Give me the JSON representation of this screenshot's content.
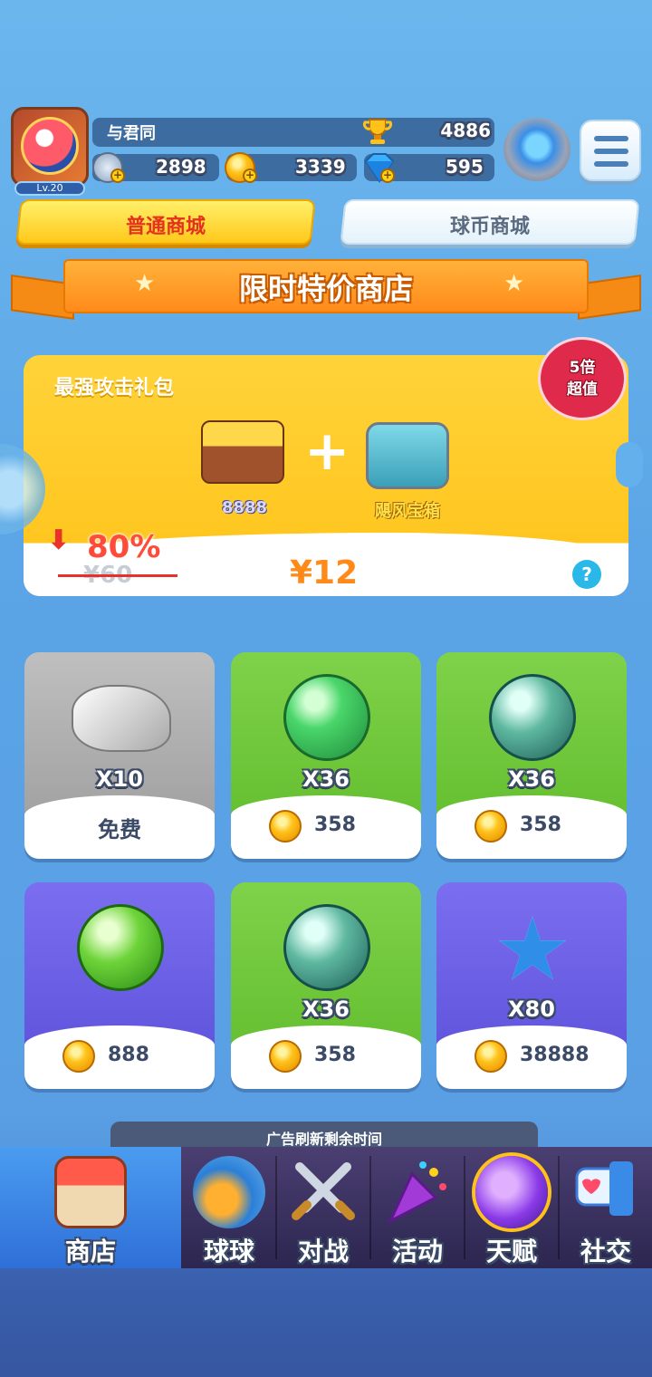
{
  "header": {
    "level": "Lv.20",
    "player_name": "与君同",
    "trophies": "4886",
    "energy": "2898",
    "coins": "3339",
    "gems": "595"
  },
  "tabs": [
    {
      "label": "普通商城",
      "active": true
    },
    {
      "label": "球币商城",
      "active": false
    }
  ],
  "banner": {
    "title": "限时特价商店"
  },
  "offer": {
    "title": "最强攻击礼包",
    "badge_line1": "5倍",
    "badge_line2": "超值",
    "item1_label": "8888",
    "item2_label": "飓风宝箱",
    "discount": "80%",
    "old_price": "¥60",
    "new_price": "¥12",
    "help": "?"
  },
  "items": [
    {
      "icon": "rock-icon",
      "qty": "X10",
      "price": "免费",
      "free": true,
      "theme": "gray"
    },
    {
      "icon": "skull-orb-icon",
      "qty": "X36",
      "price": "358",
      "free": false,
      "theme": "green"
    },
    {
      "icon": "chain-orb-icon",
      "qty": "X36",
      "price": "358",
      "free": false,
      "theme": "green"
    },
    {
      "icon": "radiation-orb-icon",
      "qty": "",
      "price": "888",
      "free": false,
      "theme": "purple"
    },
    {
      "icon": "chain-orb-icon",
      "qty": "X36",
      "price": "358",
      "free": false,
      "theme": "green"
    },
    {
      "icon": "star-icon",
      "qty": "X80",
      "price": "38888",
      "free": false,
      "theme": "purple"
    }
  ],
  "refresh": {
    "label": "广告刷新剩余时间"
  },
  "nav": [
    {
      "label": "商店",
      "icon": "shop-icon",
      "active": true
    },
    {
      "label": "球球",
      "icon": "balls-icon",
      "active": false
    },
    {
      "label": "对战",
      "icon": "swords-icon",
      "active": false
    },
    {
      "label": "活动",
      "icon": "party-popper-icon",
      "active": false
    },
    {
      "label": "天赋",
      "icon": "planet-icon",
      "active": false
    },
    {
      "label": "社交",
      "icon": "chat-heart-icon",
      "active": false
    }
  ],
  "colors": {
    "accent_yellow": "#ffc81a",
    "card_green": "#5fbb2a",
    "card_purple": "#5a4fd8",
    "nav_active": "#2f6fd8"
  }
}
